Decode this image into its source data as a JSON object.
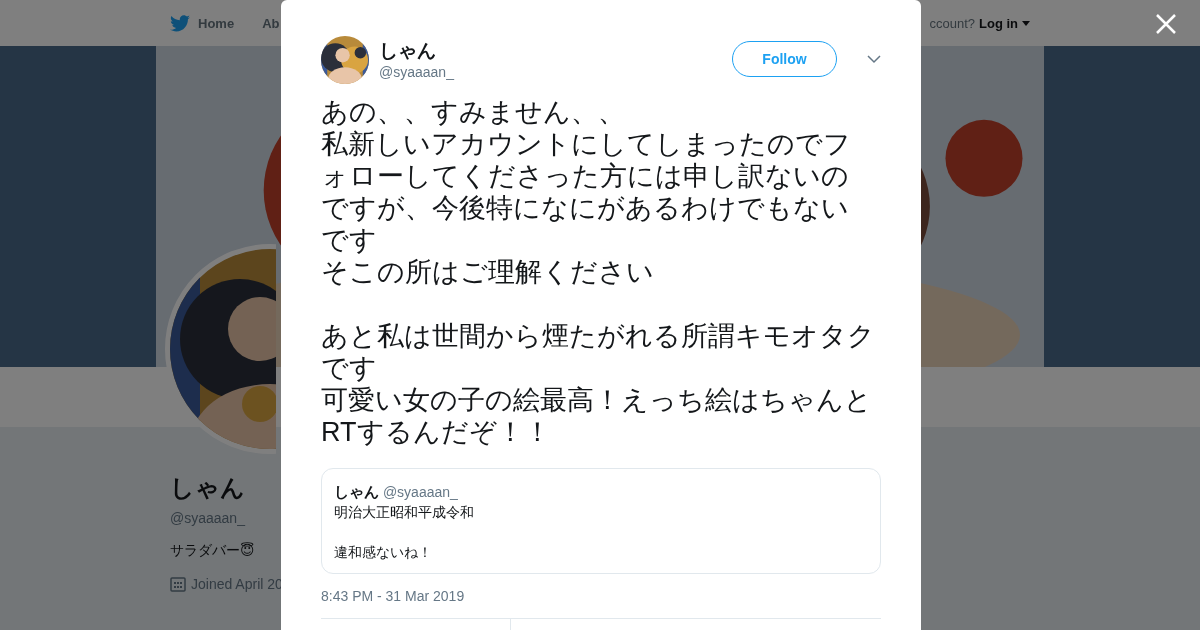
{
  "nav": {
    "items": [
      "Home",
      "Ab"
    ],
    "account_prompt": "ccount?",
    "login": "Log in"
  },
  "profile": {
    "name": "しゃん",
    "handle": "@syaaaan_",
    "bio": "サラダバー😇",
    "joined": "Joined April 20"
  },
  "tweet": {
    "author": {
      "name": "しゃん",
      "handle": "@syaaaan_"
    },
    "follow_button": "Follow",
    "paragraphs": [
      [
        "あの、、すみません、、",
        "私新しいアカウントにしてしまったのでフ",
        "ォローしてくださった方には申し訳ないの",
        "ですが、今後特になにがあるわけでもない",
        "です",
        "そこの所はご理解ください"
      ],
      [
        "あと私は世間から煙たがれる所謂キモオタク",
        "です",
        "可愛い女の子の絵最高！えっち絵はちゃんと",
        "RTするんだぞ！！"
      ]
    ],
    "quoted": {
      "name": "しゃん",
      "handle": "@syaaaan_",
      "paragraphs": [
        [
          "明治大正昭和平成令和"
        ],
        [
          "違和感ないね！"
        ]
      ]
    },
    "timestamp": "8:43 PM - 31 Mar 2019"
  }
}
